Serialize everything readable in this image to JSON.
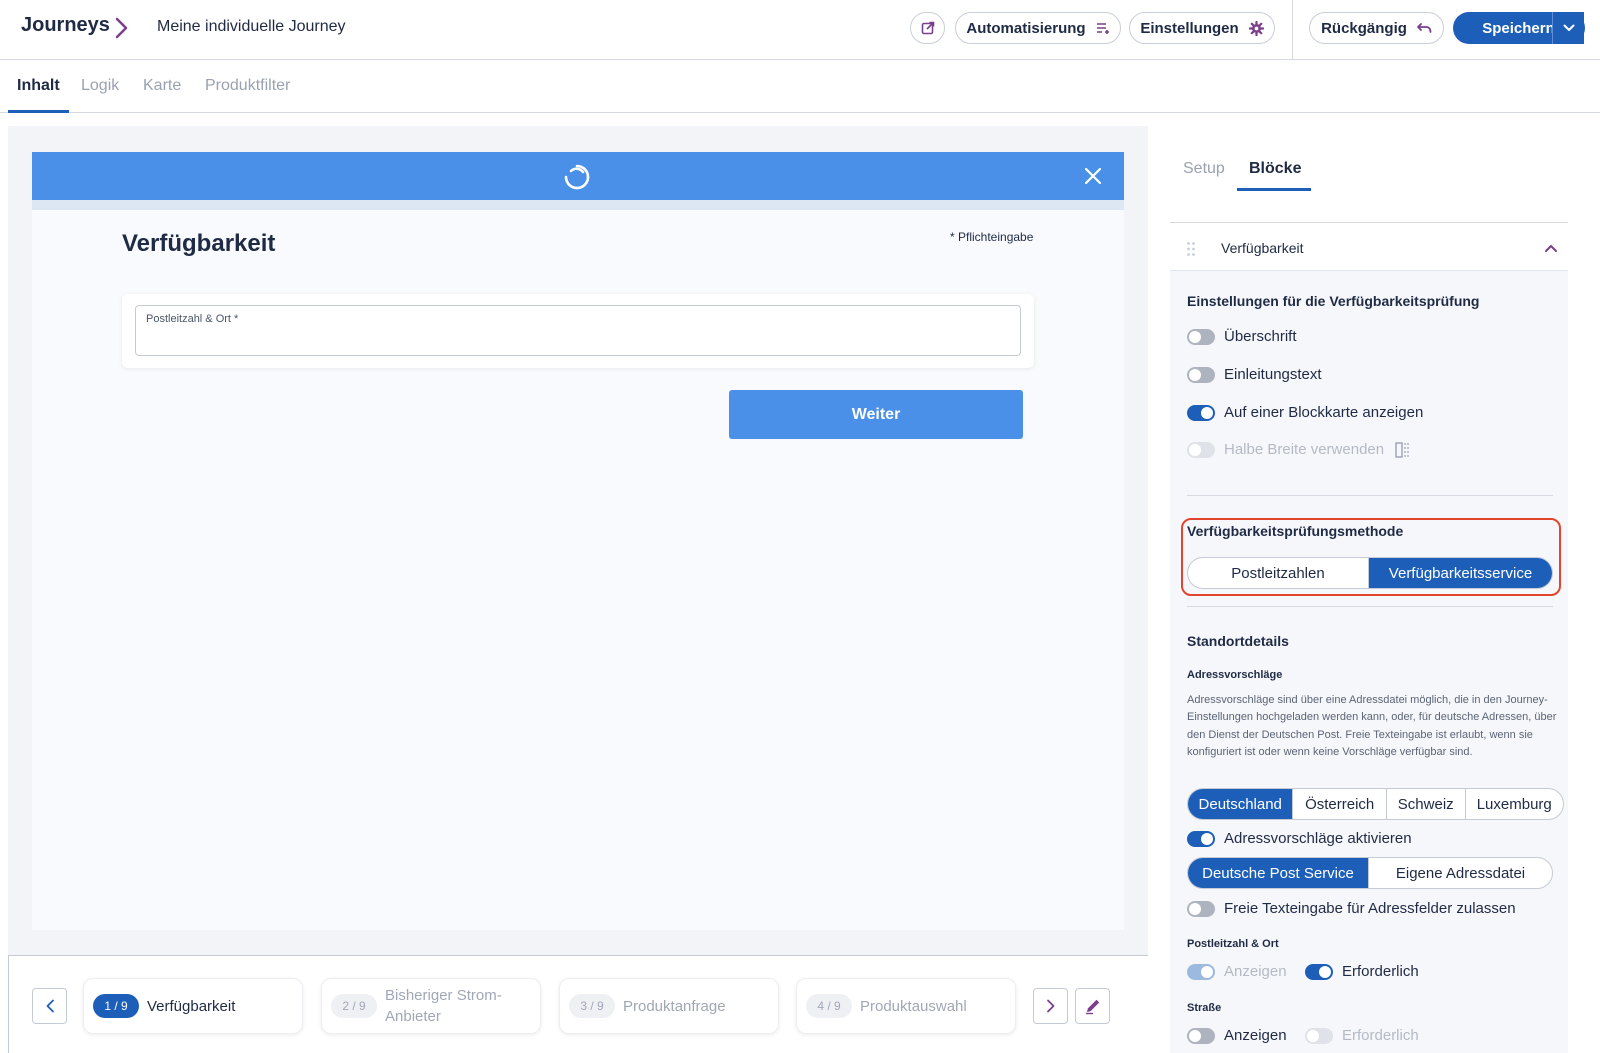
{
  "header": {
    "brand": "Journeys",
    "journey_name": "Meine individuelle Journey",
    "automation_label": "Automatisierung",
    "settings_label": "Einstellungen",
    "undo_label": "Rückgängig",
    "save_label": "Speichern",
    "accent_color": "#1d5fb8"
  },
  "tabs": {
    "items": [
      "Inhalt",
      "Logik",
      "Karte",
      "Produktfilter"
    ],
    "active": "Inhalt"
  },
  "preview": {
    "header_color": "#4a90e8",
    "title": "Verfügbarkeit",
    "required_note": "* Pflichteingabe",
    "field_label": "Postleitzahl & Ort *",
    "next_button": "Weiter"
  },
  "steps": [
    {
      "badge": "1 / 9",
      "label": "Verfügbarkeit",
      "active": true
    },
    {
      "badge": "2 / 9",
      "label": "Bisheriger Strom-Anbieter",
      "active": false
    },
    {
      "badge": "3 / 9",
      "label": "Produktanfrage",
      "active": false
    },
    {
      "badge": "4 / 9",
      "label": "Produktauswahl",
      "active": false
    }
  ],
  "panel": {
    "tabs": [
      "Setup",
      "Blöcke"
    ],
    "active_tab": "Blöcke",
    "block_title": "Verfügbarkeit",
    "settings_title": "Einstellungen für die Verfügbarkeitsprüfung",
    "toggles": [
      {
        "label": "Überschrift",
        "on": false
      },
      {
        "label": "Einleitungstext",
        "on": false
      },
      {
        "label": "Auf einer Blockkarte anzeigen",
        "on": true
      },
      {
        "label": "Halbe Breite verwenden",
        "on": false,
        "disabled": true
      }
    ],
    "method_title": "Verfügbarkeitsprüfungsmethode",
    "method_options": [
      "Postleitzahlen",
      "Verfügbarkeitsservice"
    ],
    "method_selected": "Verfügbarkeitsservice",
    "location_title": "Standortdetails",
    "address_suggestions_title": "Adressvorschläge",
    "address_suggestions_desc": "Adressvorschläge sind über eine Adressdatei möglich, die in den Journey-Einstellungen hochgeladen werden kann, oder, für deutsche Adressen, über den Dienst der Deutschen Post. Freie Texteingabe ist erlaubt, wenn sie konfiguriert ist oder wenn keine Vorschläge verfügbar sind.",
    "countries": [
      "Deutschland",
      "Österreich",
      "Schweiz",
      "Luxemburg"
    ],
    "country_selected": "Deutschland",
    "activate_suggestions_label": "Adressvorschläge aktivieren",
    "activate_suggestions_on": true,
    "services": [
      "Deutsche Post Service",
      "Eigene Adressdatei"
    ],
    "service_selected": "Deutsche Post Service",
    "free_text_label": "Freie Texteingabe für Adressfelder zulassen",
    "free_text_on": false,
    "zip_title": "Postleitzahl & Ort",
    "zip_show_label": "Anzeigen",
    "zip_show_on": true,
    "zip_required_label": "Erforderlich",
    "zip_required_on": true,
    "street_title": "Straße",
    "street_show_label": "Anzeigen",
    "street_show_on": false,
    "street_required_label": "Erforderlich",
    "street_required_on": false,
    "highlight_color": "#e2452e"
  }
}
